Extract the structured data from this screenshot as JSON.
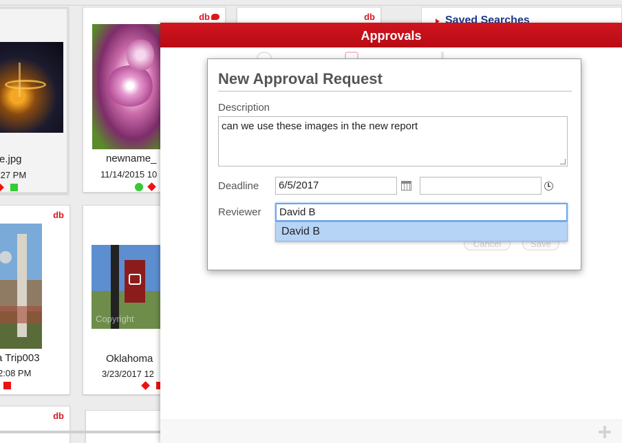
{
  "cards": [
    {
      "name": "e.jpg",
      "date": ":27 PM",
      "db": "db"
    },
    {
      "name": "newname_",
      "date": "11/14/2015 10",
      "db": "db"
    },
    {
      "name": "",
      "date": "",
      "db": "db"
    },
    {
      "name": "a Trip003",
      "date": "2:08 PM",
      "db": "db"
    },
    {
      "name": "Oklahoma",
      "date": "3/23/2017 12",
      "db": "db",
      "watermark": "Copyright"
    },
    {
      "name": "",
      "date": "",
      "db": "db"
    }
  ],
  "saved_searches": {
    "title": "Saved Searches"
  },
  "panel": {
    "title": "Approvals"
  },
  "dialog": {
    "title": "New Approval Request",
    "description_label": "Description",
    "description_value": "can we use these images in the new report",
    "deadline_label": "Deadline",
    "deadline_date": "6/5/2017",
    "deadline_time": "",
    "reviewer_label": "Reviewer",
    "reviewer_value": "David B",
    "suggestion": "David B",
    "cancel_label": "Cancel",
    "save_label": "Save"
  },
  "colors": {
    "brand_red": "#c8102e",
    "focus_blue": "#6ea6e8",
    "suggestion_bg": "#b6d4f6"
  },
  "icons": [
    "calendar-icon",
    "clock-icon",
    "plus-icon",
    "comment-icon"
  ]
}
